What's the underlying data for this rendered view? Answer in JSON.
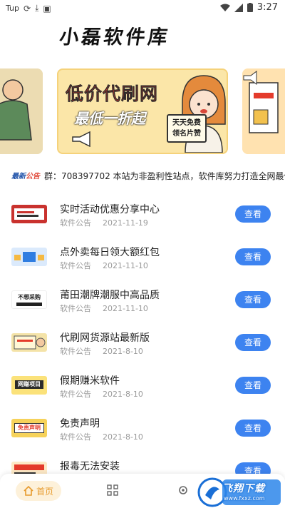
{
  "status_bar": {
    "carrier": "Tup",
    "time": "3:27"
  },
  "app": {
    "title": "小磊软件库"
  },
  "banner": {
    "headline": "低价代刷网",
    "subline": "最低一折起",
    "sign_line1": "天天免费",
    "sign_line2": "领名片赞"
  },
  "notice": {
    "badge_main": "最新",
    "badge_accent": "公告",
    "text": "群：708397702 本站为非盈利性站点，软件库努力打造全网最优"
  },
  "list": {
    "button_label": "查看",
    "category": "软件公告",
    "items": [
      {
        "title": "实时活动优惠分享中心",
        "date": "2021-11-19"
      },
      {
        "title": "点外卖每日领大额红包",
        "date": "2021-11-10"
      },
      {
        "title": "莆田潮牌潮服中高品质",
        "date": "2021-11-10"
      },
      {
        "title": "代刷网货源站最新版",
        "date": "2021-8-10"
      },
      {
        "title": "假期赚米软件",
        "date": "2021-8-10"
      },
      {
        "title": "免责声明",
        "date": "2021-8-10"
      },
      {
        "title": "报毒无法安装",
        "date": ""
      }
    ],
    "thumb_texts": [
      "不想采购",
      "网赚项目",
      "免责声明"
    ]
  },
  "bottom_nav": {
    "home_label": "首页"
  },
  "watermark": {
    "text": "飞翔下载",
    "url": "www.fxxz.com"
  },
  "colors": {
    "accent_blue": "#3d83f0",
    "home_active": "#e79a2c",
    "banner_red": "#e43b2b"
  }
}
